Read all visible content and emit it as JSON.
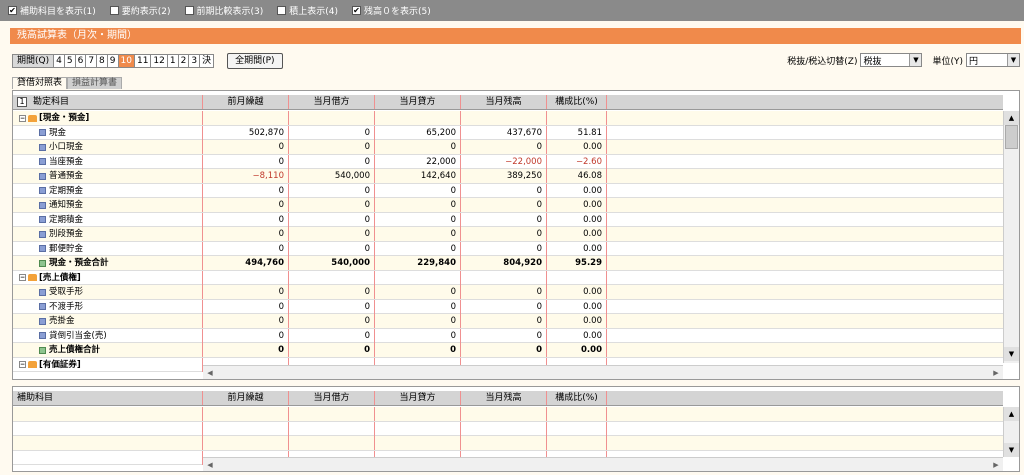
{
  "options": [
    {
      "label": "補助科目を表示(1)",
      "checked": true
    },
    {
      "label": "要約表示(2)",
      "checked": false
    },
    {
      "label": "前期比較表示(3)",
      "checked": false
    },
    {
      "label": "積上表示(4)",
      "checked": false
    },
    {
      "label": "残高０を表示(5)",
      "checked": true
    }
  ],
  "title": "残高試算表（月次・期間）",
  "period": {
    "label": "期間(Q)",
    "months": [
      "4",
      "5",
      "6",
      "7",
      "8",
      "9",
      "10",
      "11",
      "12",
      "1",
      "2",
      "3",
      "決"
    ],
    "active": "10",
    "full_label": "全期間(P)"
  },
  "tax": {
    "label": "税抜/税込切替(Z)",
    "value": "税抜",
    "unit_label": "単位(Y)",
    "unit_value": "円"
  },
  "tabs": [
    "貸借対照表",
    "損益計算書"
  ],
  "columns": [
    "勘定科目",
    "前月繰越",
    "当月借方",
    "当月貸方",
    "当月残高",
    "構成比(%)"
  ],
  "corner_number": "1",
  "rows": [
    {
      "type": "group",
      "name": "[現金・預金]"
    },
    {
      "type": "leaf",
      "name": "現金",
      "values": [
        "502,870",
        "0",
        "65,200",
        "437,670",
        "51.81"
      ]
    },
    {
      "type": "leaf",
      "name": "小口現金",
      "values": [
        "0",
        "0",
        "0",
        "0",
        "0.00"
      ]
    },
    {
      "type": "leaf",
      "name": "当座預金",
      "values": [
        "0",
        "0",
        "22,000",
        "−22,000",
        "−2.60"
      ]
    },
    {
      "type": "leaf",
      "name": "普通預金",
      "values": [
        "−8,110",
        "540,000",
        "142,640",
        "389,250",
        "46.08"
      ]
    },
    {
      "type": "leaf",
      "name": "定期預金",
      "values": [
        "0",
        "0",
        "0",
        "0",
        "0.00"
      ]
    },
    {
      "type": "leaf",
      "name": "通知預金",
      "values": [
        "0",
        "0",
        "0",
        "0",
        "0.00"
      ]
    },
    {
      "type": "leaf",
      "name": "定期積金",
      "values": [
        "0",
        "0",
        "0",
        "0",
        "0.00"
      ]
    },
    {
      "type": "leaf",
      "name": "別段預金",
      "values": [
        "0",
        "0",
        "0",
        "0",
        "0.00"
      ]
    },
    {
      "type": "leaf",
      "name": "郵便貯金",
      "values": [
        "0",
        "0",
        "0",
        "0",
        "0.00"
      ]
    },
    {
      "type": "sum",
      "name": "現金・預金合計",
      "values": [
        "494,760",
        "540,000",
        "229,840",
        "804,920",
        "95.29"
      ]
    },
    {
      "type": "group",
      "name": "[売上債権]"
    },
    {
      "type": "leaf",
      "name": "受取手形",
      "values": [
        "0",
        "0",
        "0",
        "0",
        "0.00"
      ]
    },
    {
      "type": "leaf",
      "name": "不渡手形",
      "values": [
        "0",
        "0",
        "0",
        "0",
        "0.00"
      ]
    },
    {
      "type": "leaf",
      "name": "売掛金",
      "values": [
        "0",
        "0",
        "0",
        "0",
        "0.00"
      ]
    },
    {
      "type": "leaf",
      "name": "貸倒引当金(売)",
      "values": [
        "0",
        "0",
        "0",
        "0",
        "0.00"
      ]
    },
    {
      "type": "sum",
      "name": "売上債権合計",
      "values": [
        "0",
        "0",
        "0",
        "0",
        "0.00"
      ]
    },
    {
      "type": "group",
      "name": "[有価証券]"
    }
  ],
  "sub_columns": [
    "補助科目",
    "前月繰越",
    "当月借方",
    "当月貸方",
    "当月残高",
    "構成比(%)"
  ],
  "colors": {
    "accent": "#f08a4b",
    "negative": "#c0392b",
    "gridline": "#f09090"
  }
}
